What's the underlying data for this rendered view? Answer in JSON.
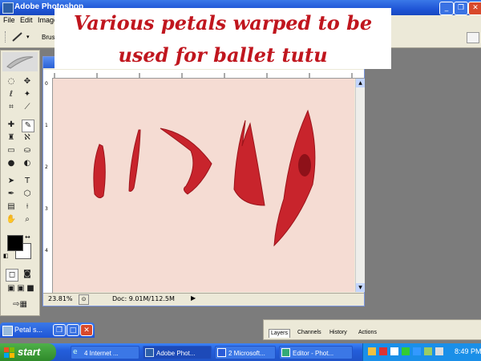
{
  "window": {
    "title": "Adobe Photoshop"
  },
  "menu": {
    "items": [
      "File",
      "Edit",
      "Image"
    ]
  },
  "options": {
    "brush_label": "Brus"
  },
  "caption": {
    "line1": "Various petals warped to be",
    "line2": "used for ballet tutu"
  },
  "document": {
    "zoom": "23.81%",
    "doc_info": "Doc: 9.01M/112.5M",
    "canvas_color": "#f5dcd3",
    "petal_color": "#c8242c",
    "ruler_numbers": [
      "0",
      "1",
      "2",
      "3",
      "4"
    ]
  },
  "minimized_window": {
    "label": "Petal s..."
  },
  "palette": {
    "tabs": [
      "Layers",
      "Channels",
      "History",
      "Actions"
    ]
  },
  "taskbar": {
    "start_label": "start",
    "tasks": [
      "4 Internet ...",
      "Adobe Phot...",
      "2 Microsoft...",
      "Editor - Phot..."
    ],
    "clock": "8:49 PM"
  }
}
